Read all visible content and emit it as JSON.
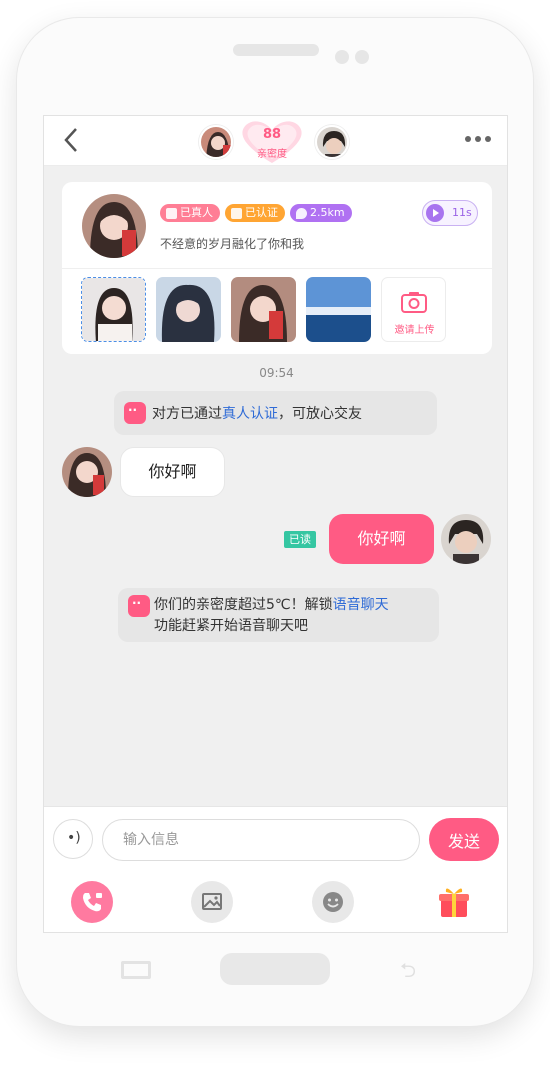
{
  "header": {
    "intimacy_value": "88",
    "intimacy_label": "亲密度"
  },
  "profile": {
    "badges": [
      {
        "label": "已真人",
        "color": "#ff7e95"
      },
      {
        "label": "已认证",
        "color": "#ffa533"
      },
      {
        "label": "2.5km",
        "color": "#b071f2"
      }
    ],
    "signature": "不经意的岁月融化了你和我",
    "voice_duration": "11s",
    "invite_upload_label": "邀请上传"
  },
  "chat": {
    "time": "09:54",
    "system_msg_1": {
      "prefix": "对方已通过",
      "link": "真人认证",
      "suffix": "，可放心交友"
    },
    "incoming_msg": "你好啊",
    "read_tag": "已读",
    "outgoing_msg": "你好啊",
    "system_msg_2": {
      "line1_prefix": "你们的亲密度超过5℃！解锁",
      "line1_link": "语音聊天",
      "line2": "功能赶紧开始语音聊天吧"
    }
  },
  "composer": {
    "placeholder": "输入信息",
    "send_label": "发送"
  },
  "colors": {
    "accent": "#ff5b84",
    "link": "#2f6bd6",
    "read": "#35c6a2"
  }
}
